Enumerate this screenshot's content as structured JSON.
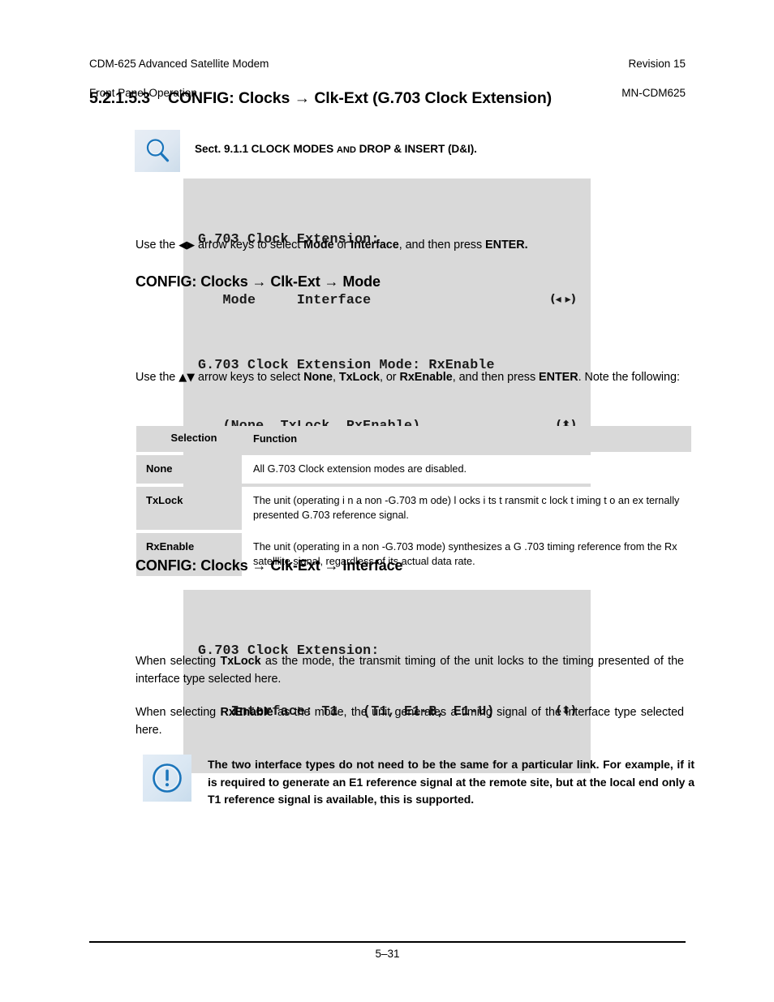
{
  "header": {
    "left_line1": "CDM-625 Advanced Satellite Modem",
    "left_line2": "Front Panel Operation",
    "right_line1": "Revision 15",
    "right_line2": "MN-CDM625"
  },
  "section": {
    "number": "5.2.1.5.3",
    "title": "CONFIG: Clocks → Clk-Ext (G.703 Clock Extension)"
  },
  "callouts": {
    "magnifier": {
      "icon": "magnifier-icon",
      "text_part1": "Sect. 9.1.1 CLOCK MODES ",
      "text_smallcaps": "AND",
      "text_part2": " DROP & INSERT (D&I)."
    },
    "important": {
      "icon": "exclamation-circle-icon",
      "text": "The two interface types do not need to be the same for a particular link. For example, if it is required to generate an E1 reference signal at the remote site, but at the local end only a T1 reference signal is available, this is supported."
    }
  },
  "lcd_displays": {
    "clk_ext_root": {
      "line1": "G.703 Clock Extension:",
      "line2_text": "   Mode     Interface",
      "line2_arrows": "(◂ ▸)"
    },
    "mode": {
      "line1": "G.703 Clock Extension Mode: RxEnable",
      "line2_text": "   (None, TxLock, RxEnable)",
      "line2_arrows": "(⬍)"
    },
    "interface": {
      "line1": "G.703 Clock Extension:",
      "line2_text": "    Interface: T1   (T1, E1-B, E1-U)",
      "line2_arrows": "(⬍)"
    }
  },
  "paragraphs": {
    "arrows_mode_interface": {
      "seg1": "Use the ",
      "arrows": "◀▶",
      "seg2": " arrow keys to select ",
      "bold1": "Mode",
      "seg3": " or ",
      "bold2": "Interface",
      "seg4": ", and then press ",
      "bold3": "ENTER."
    },
    "arrows_none_txlock": {
      "seg1": "Use the ",
      "arrows": "▲▼",
      "seg2": " arrow keys to select ",
      "bold1": "None",
      "seg3": ", ",
      "bold2": "TxLock",
      "seg4": ", or ",
      "bold3": "RxEnable",
      "seg5": ", and then press ",
      "bold4": "ENTER",
      "seg6": ". Note the following:"
    },
    "txlock_mode": {
      "seg1": "When selecting ",
      "bold1": "TxLock",
      "seg2": " as the mode, the transmit timing of the unit locks to the timing presented of the interface type selected here."
    },
    "rxenable_mode": {
      "seg1": "When selecting ",
      "bold1": "RxEnable",
      "seg2": " as the mode, the unit generates a timing signal of the interface type selected here."
    }
  },
  "subheadings": {
    "mode": "CONFIG: Clocks → Clk-Ext → Mode",
    "interface": "CONFIG: Clocks → Clk-Ext → Interface"
  },
  "table": {
    "columns": [
      "Selection",
      "Function"
    ],
    "rows": [
      {
        "selection": "None",
        "function": "All G.703 Clock extension modes are disabled."
      },
      {
        "selection": "TxLock",
        "function": "The  unit  (operating i n a non  -G.703 m ode) l ocks i ts t ransmit c lock t iming t o an ex  ternally presented G.703 reference signal."
      },
      {
        "selection": "RxEnable",
        "function": "The unit (operating in a non -G.703 mode) synthesizes a G .703 timing reference from the Rx satelllite signal, regardless of its actual data rate."
      }
    ]
  },
  "footer": {
    "page_number": "5–31"
  },
  "colors": {
    "lcd_background": "#d9d9d9",
    "table_gray": "#d9d9d9",
    "icon_blue": "#1b75bb",
    "icon_box_blue": "#dfe8f2"
  }
}
